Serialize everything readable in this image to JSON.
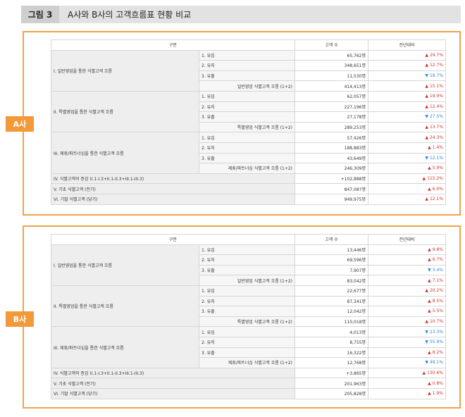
{
  "figure": {
    "label": "그림 3",
    "title": "A사와 B사의 고객흐름표 현황 비교"
  },
  "colors": {
    "accent": "#f29a3a",
    "up": "#d0322f",
    "down": "#2f86d4",
    "header_bg": "#f0f1cf"
  },
  "columns": {
    "category": "구분",
    "count": "고객 수",
    "yoy": "전년대비"
  },
  "panels": [
    {
      "tag": "A사",
      "groups": [
        {
          "label": "I. 일반영업을 통한 식별고객 흐름",
          "rows": [
            {
              "label": "1. 유입",
              "count": "65,762명",
              "dir": "up",
              "change": "29.7%"
            },
            {
              "label": "2. 유지",
              "count": "348,651명",
              "dir": "up",
              "change": "12.7%"
            },
            {
              "label": "3. 유출",
              "count": "11,530명",
              "dir": "down",
              "change": "18.7%"
            }
          ],
          "subtotal": {
            "label": "일반영업 식별고객 흐름 (1+2)",
            "count": "414,413명",
            "dir": "up",
            "change": "15.1%"
          }
        },
        {
          "label": "II. 특별영업을 통한 식별고객 흐름",
          "rows": [
            {
              "label": "1. 유입",
              "count": "62,057명",
              "dir": "up",
              "change": "19.9%"
            },
            {
              "label": "2. 유지",
              "count": "227,196명",
              "dir": "up",
              "change": "12.4%"
            },
            {
              "label": "3. 유출",
              "count": "27,178명",
              "dir": "down",
              "change": "27.5%"
            }
          ],
          "subtotal": {
            "label": "특별영업 식별고객 흐름 (1+2)",
            "count": "289,253명",
            "dir": "up",
            "change": "13.7%"
          }
        },
        {
          "label": "III. 제휴/파트너십을 통한 식별고객 흐름",
          "rows": [
            {
              "label": "1. 유입",
              "count": "57,426명",
              "dir": "up",
              "change": "24.3%"
            },
            {
              "label": "2. 유지",
              "count": "188,883명",
              "dir": "up",
              "change": "1.4%"
            },
            {
              "label": "3. 유출",
              "count": "43,649명",
              "dir": "down",
              "change": "12.1%"
            }
          ],
          "subtotal": {
            "label": "제휴/파트너십 식별고객 흐름 (1+2)",
            "count": "246,309명",
            "dir": "up",
            "change": "5.9%"
          }
        }
      ],
      "totals": [
        {
          "label": "IV. 식별고객의 증감 (I.1-I.3+II.1-II.3+III.1-III.3)",
          "count": "+102,888명",
          "dir": "up",
          "change": "115.2%"
        },
        {
          "label": "V. 기초 식별고객 (전기)",
          "count": "847,087명",
          "dir": "up",
          "change": "6.0%"
        },
        {
          "label": "VI. 기말 식별고객 (당기)",
          "count": "949,975명",
          "dir": "up",
          "change": "12.1%"
        }
      ]
    },
    {
      "tag": "B사",
      "groups": [
        {
          "label": "I. 일반영업을 통한 식별고객 흐름",
          "rows": [
            {
              "label": "1. 유입",
              "count": "13,446명",
              "dir": "up",
              "change": "9.8%"
            },
            {
              "label": "2. 유지",
              "count": "69,596명",
              "dir": "up",
              "change": "6.7%"
            },
            {
              "label": "3. 유출",
              "count": "7,907명",
              "dir": "down",
              "change": "3.4%"
            }
          ],
          "subtotal": {
            "label": "일반영업 식별고객 흐름 (1+2)",
            "count": "83,042명",
            "dir": "up",
            "change": "7.1%"
          }
        },
        {
          "label": "II. 특별영업을 통한 식별고객 흐름",
          "rows": [
            {
              "label": "1. 유입",
              "count": "22,677명",
              "dir": "up",
              "change": "20.2%"
            },
            {
              "label": "2. 유지",
              "count": "87,341명",
              "dir": "up",
              "change": "8.5%"
            },
            {
              "label": "3. 유출",
              "count": "12,042명",
              "dir": "up",
              "change": "5.5%"
            }
          ],
          "subtotal": {
            "label": "특별영업 식별고객 흐름 (1+2)",
            "count": "110,018명",
            "dir": "up",
            "change": "10.7%"
          }
        },
        {
          "label": "III. 제휴/파트너십을 통한 식별고객 흐름",
          "rows": [
            {
              "label": "1. 유입",
              "count": "4,013명",
              "dir": "down",
              "change": "23.3%"
            },
            {
              "label": "2. 유지",
              "count": "8,755명",
              "dir": "down",
              "change": "55.9%"
            },
            {
              "label": "3. 유출",
              "count": "16,322명",
              "dir": "up",
              "change": "8.2%"
            }
          ],
          "subtotal": {
            "label": "제휴/파트너십 식별고객 흐름 (1+2)",
            "count": "12,768명",
            "dir": "down",
            "change": "49.1%"
          }
        }
      ],
      "totals": [
        {
          "label": "IV. 식별고객의 증감 (I.1-I.3+II.1-II.3+III.1-III.3)",
          "count": "+3,865명",
          "dir": "up",
          "change": "130.6%"
        },
        {
          "label": "V. 기초 식별고객 (전기)",
          "count": "201,963명",
          "dir": "up",
          "change": "0.8%"
        },
        {
          "label": "VI. 기말 식별고객 (당기)",
          "count": "205,828명",
          "dir": "up",
          "change": "1.9%"
        }
      ]
    }
  ]
}
